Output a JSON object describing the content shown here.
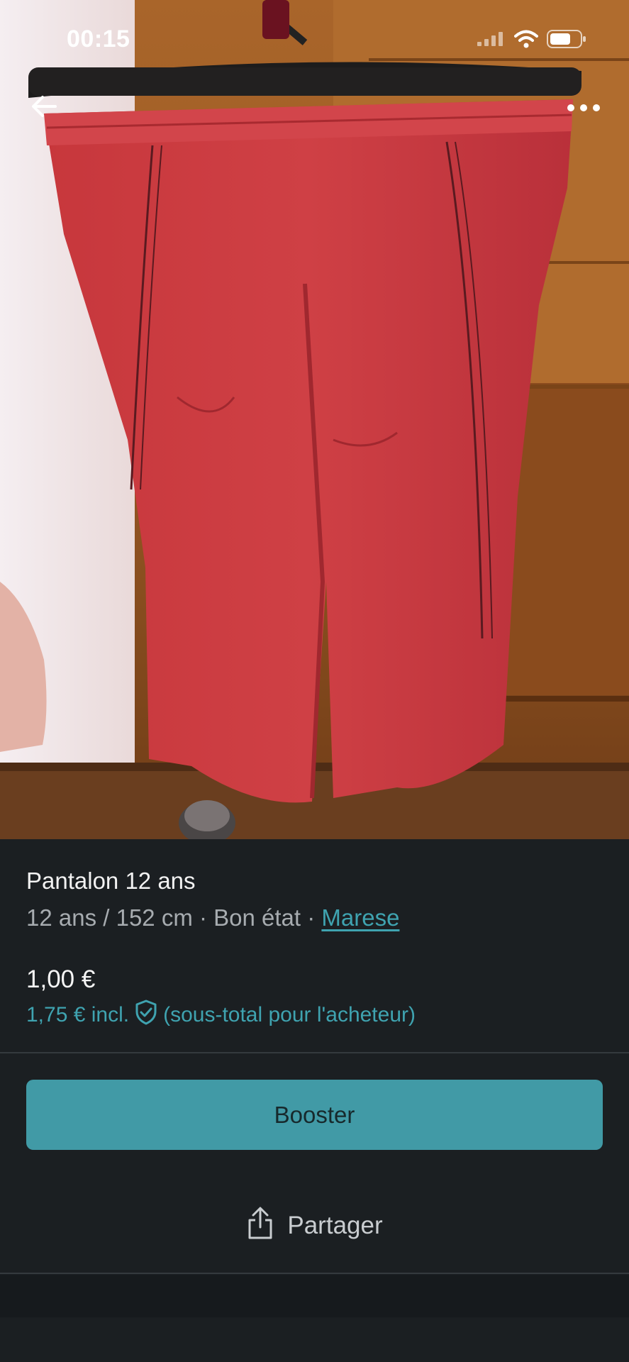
{
  "status_bar": {
    "time": "00:15"
  },
  "top_bar": {
    "back_icon": "arrow-left-icon",
    "more_icon": "more-horizontal-icon"
  },
  "photo": {
    "subject": "red-trousers-on-hanger"
  },
  "item": {
    "title": "Pantalon 12 ans",
    "size": "12 ans / 152 cm",
    "separator": " · ",
    "condition": "Bon état",
    "brand": "Marese",
    "price": "1,00 €",
    "price_incl": "1,75 € incl.",
    "buyer_protection_icon": "shield-check-icon",
    "price_note": "(sous-total pour l'acheteur)"
  },
  "actions": {
    "booster_label": "Booster",
    "share_label": "Partager",
    "share_icon": "share-icon"
  },
  "colors": {
    "background": "#1b1f22",
    "accent": "#419aa6",
    "link": "#3fa3b0",
    "product": "#c73a3f"
  }
}
